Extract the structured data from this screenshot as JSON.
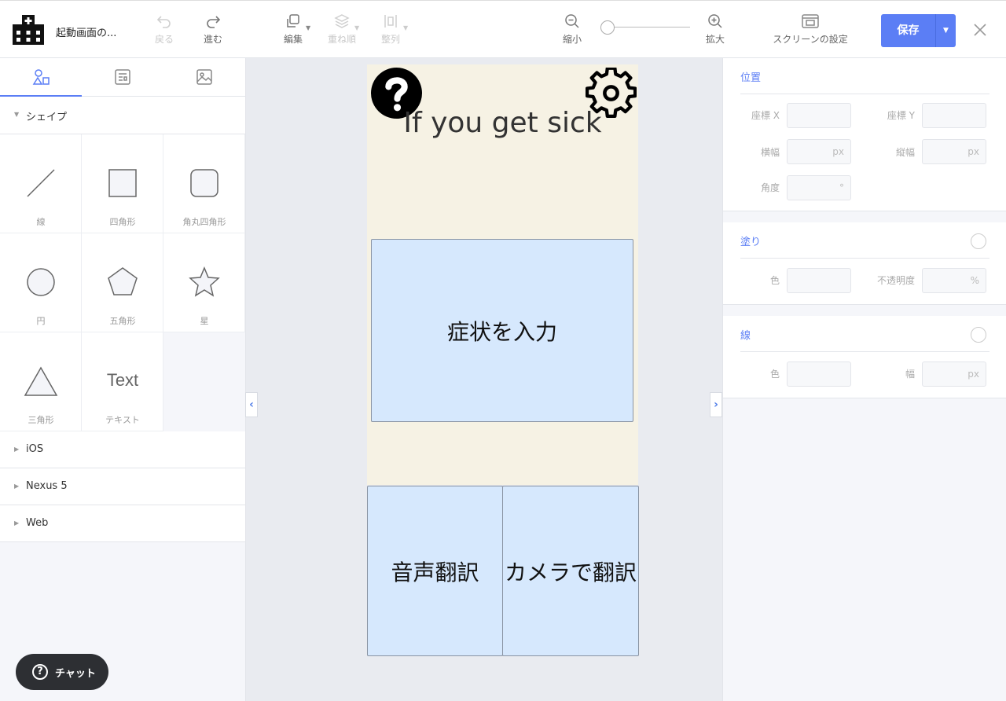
{
  "app": {
    "doc_title": "起動画面の..."
  },
  "toolbar": {
    "undo": "戻る",
    "redo": "進む",
    "edit": "編集",
    "order": "重ね順",
    "align": "整列",
    "zoom_out": "縮小",
    "zoom_in": "拡大",
    "screen_settings": "スクリーンの設定",
    "save": "保存",
    "zoom_level": 0.1
  },
  "left_panel": {
    "shapes_section": "シェイプ",
    "shapes": [
      {
        "label": "線",
        "icon": "line-icon"
      },
      {
        "label": "四角形",
        "icon": "rectangle-icon"
      },
      {
        "label": "角丸四角形",
        "icon": "rounded-rectangle-icon"
      },
      {
        "label": "円",
        "icon": "circle-icon"
      },
      {
        "label": "五角形",
        "icon": "pentagon-icon"
      },
      {
        "label": "星",
        "icon": "star-icon"
      },
      {
        "label": "三角形",
        "icon": "triangle-icon"
      },
      {
        "label": "テキスト",
        "icon": "text-icon",
        "glyph": "Text"
      }
    ],
    "categories": [
      "iOS",
      "Nexus 5",
      "Web"
    ],
    "chat": "チャット"
  },
  "canvas": {
    "screen_title": "If you get sick",
    "button_symptoms": "症状を入力",
    "button_voice": "音声翻訳",
    "button_camera": "カメラで翻訳"
  },
  "right_panel": {
    "position": {
      "title": "位置",
      "x_label": "座標 X",
      "y_label": "座標 Y",
      "width_label": "横幅",
      "height_label": "縦幅",
      "angle_label": "角度",
      "unit_px": "px",
      "unit_deg": "°"
    },
    "fill": {
      "title": "塗り",
      "color_label": "色",
      "opacity_label": "不透明度",
      "unit_pct": "%"
    },
    "stroke": {
      "title": "線",
      "color_label": "色",
      "width_label": "幅",
      "unit_px": "px"
    }
  },
  "colors": {
    "accent": "#5b7ef5",
    "screen_bg": "#f6f2e4",
    "button_bg": "#d6e8fd"
  }
}
